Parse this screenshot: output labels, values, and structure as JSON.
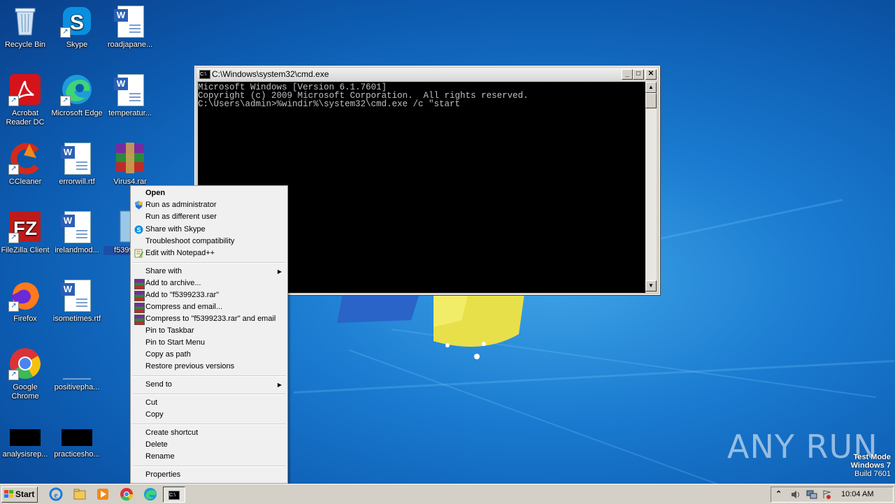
{
  "desktop_icons": [
    {
      "label": "Recycle Bin"
    },
    {
      "label": "Skype"
    },
    {
      "label": "roadjapane..."
    },
    {
      "label": "Acrobat Reader DC"
    },
    {
      "label": "Microsoft Edge"
    },
    {
      "label": "temperatur..."
    },
    {
      "label": "CCleaner"
    },
    {
      "label": "errorwill.rtf"
    },
    {
      "label": "Virus4.rar"
    },
    {
      "label": "FileZilla Client"
    },
    {
      "label": "irelandmod..."
    },
    {
      "label": "f5399233"
    },
    {
      "label": "Firefox"
    },
    {
      "label": "isometimes.rtf"
    },
    {
      "label": "Google Chrome"
    },
    {
      "label": "positivepha..."
    },
    {
      "label": "analysisrep..."
    },
    {
      "label": "practicesho..."
    }
  ],
  "cmd_window": {
    "title": "C:\\Windows\\system32\\cmd.exe",
    "icon_text": "C:\\",
    "lines": [
      "Microsoft Windows [Version 6.1.7601]",
      "Copyright (c) 2009 Microsoft Corporation.  All rights reserved.",
      "",
      "C:\\Users\\admin>%windir%\\system32\\cmd.exe /c \"start"
    ],
    "buttons": {
      "minimize": "_",
      "maximize": "□",
      "close": "✕"
    }
  },
  "context_menu": {
    "items": [
      {
        "label": "Open",
        "bold": true
      },
      {
        "label": "Run as administrator",
        "icon": "shield-icon"
      },
      {
        "label": "Run as different user"
      },
      {
        "label": "Share with Skype",
        "icon": "skype-icon"
      },
      {
        "label": "Troubleshoot compatibility"
      },
      {
        "label": "Edit with Notepad++",
        "icon": "notepad-icon"
      },
      {
        "label": "Share with",
        "submenu": true
      },
      {
        "label": "Add to archive...",
        "icon": "winrar-icon"
      },
      {
        "label": "Add to \"f5399233.rar\"",
        "icon": "winrar-icon"
      },
      {
        "label": "Compress and email...",
        "icon": "winrar-icon"
      },
      {
        "label": "Compress to \"f5399233.rar\" and email",
        "icon": "winrar-icon"
      },
      {
        "label": "Pin to Taskbar"
      },
      {
        "label": "Pin to Start Menu"
      },
      {
        "label": "Copy as path"
      },
      {
        "label": "Restore previous versions"
      },
      {
        "label": "Send to",
        "submenu": true
      },
      {
        "label": "Cut"
      },
      {
        "label": "Copy"
      },
      {
        "label": "Create shortcut"
      },
      {
        "label": "Delete"
      },
      {
        "label": "Rename"
      },
      {
        "label": "Properties"
      }
    ],
    "submenu_arrow": "▶"
  },
  "taskbar": {
    "start_label": "Start",
    "apps": [
      "ie-icon",
      "explorer-icon",
      "media-player-icon",
      "chrome-icon",
      "edge-icon",
      "cmd-icon"
    ],
    "cmd_icon_text": "C:\\",
    "clock": "10:04 AM",
    "tray_chevron": "⌃"
  },
  "watermark": {
    "line1": "Test Mode",
    "line2": "Windows 7",
    "line3": "Build 7601"
  },
  "anyrun_text": "ANY RUN"
}
